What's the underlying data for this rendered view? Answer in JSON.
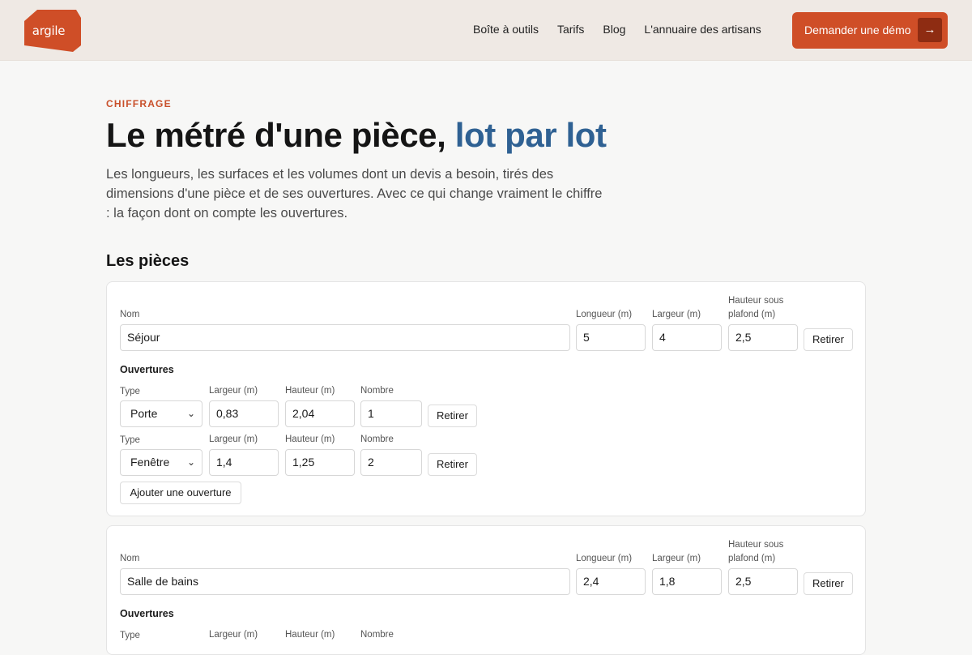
{
  "header": {
    "logo_text": "argile",
    "nav": [
      "Boîte à outils",
      "Tarifs",
      "Blog",
      "L'annuaire des artisans"
    ],
    "cta_label": "Demander une démo",
    "cta_arrow": "→",
    "brand_color": "#cf4e27"
  },
  "hero": {
    "eyebrow": "CHIFFRAGE",
    "title_main": "Le métré d'une pièce,",
    "title_accent": "lot par lot",
    "lead": "Les longueurs, les surfaces et les volumes dont un devis a besoin, tirés des dimensions d'une pièce et de ses ouvertures. Avec ce qui change vraiment le chiffre : la façon dont on compte les ouvertures."
  },
  "section_title": "Les pièces",
  "labels": {
    "name": "Nom",
    "length": "Longueur (m)",
    "width": "Largeur (m)",
    "height": "Hauteur sous plafond (m)",
    "remove": "Retirer",
    "openings": "Ouvertures",
    "type": "Type",
    "op_width": "Largeur (m)",
    "op_height": "Hauteur (m)",
    "count": "Nombre",
    "add_opening": "Ajouter une ouverture"
  },
  "rooms": [
    {
      "name": "Séjour",
      "length": "5",
      "width": "4",
      "height": "2,5",
      "openings": [
        {
          "type": "Porte",
          "width": "0,83",
          "height": "2,04",
          "count": "1"
        },
        {
          "type": "Fenêtre",
          "width": "1,4",
          "height": "1,25",
          "count": "2"
        }
      ]
    },
    {
      "name": "Salle de bains",
      "length": "2,4",
      "width": "1,8",
      "height": "2,5",
      "openings": []
    }
  ]
}
